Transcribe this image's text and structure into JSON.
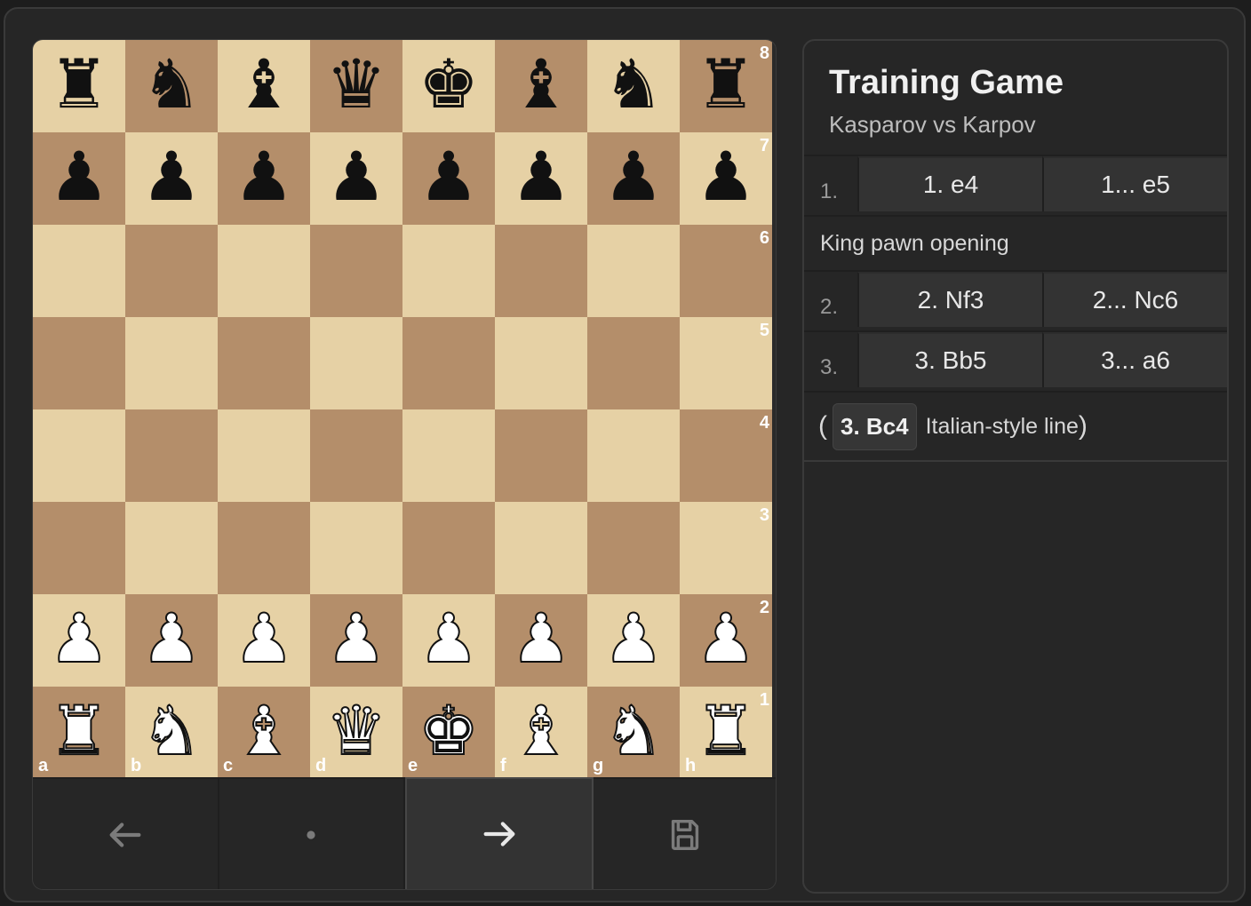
{
  "board": {
    "ranks": [
      "8",
      "7",
      "6",
      "5",
      "4",
      "3",
      "2",
      "1"
    ],
    "files": [
      "a",
      "b",
      "c",
      "d",
      "e",
      "f",
      "g",
      "h"
    ],
    "rows": [
      [
        "br",
        "bn",
        "bb",
        "bq",
        "bk",
        "bb",
        "bn",
        "br"
      ],
      [
        "bp",
        "bp",
        "bp",
        "bp",
        "bp",
        "bp",
        "bp",
        "bp"
      ],
      [
        "",
        "",
        "",
        "",
        "",
        "",
        "",
        ""
      ],
      [
        "",
        "",
        "",
        "",
        "",
        "",
        "",
        ""
      ],
      [
        "",
        "",
        "",
        "",
        "",
        "",
        "",
        ""
      ],
      [
        "",
        "",
        "",
        "",
        "",
        "",
        "",
        ""
      ],
      [
        "wp",
        "wp",
        "wp",
        "wp",
        "wp",
        "wp",
        "wp",
        "wp"
      ],
      [
        "wr",
        "wn",
        "wb",
        "wq",
        "wk",
        "wb",
        "wn",
        "wr"
      ]
    ],
    "light_color": "#e6d1a5",
    "dark_color": "#b48e6a"
  },
  "controls": [
    {
      "icon": "arrow-left-icon"
    },
    {
      "icon": "dot-icon"
    },
    {
      "icon": "arrow-right-icon"
    },
    {
      "icon": "save-icon"
    }
  ],
  "panel": {
    "title": "Training Game",
    "subtitle": "Kasparov vs Karpov",
    "moves": [
      {
        "num": "1.",
        "white": "1. e4",
        "black": "1... e5",
        "comment": "King pawn opening"
      },
      {
        "num": "2.",
        "white": "2. Nf3",
        "black": "2... Nc6",
        "comment": ""
      },
      {
        "num": "3.",
        "white": "3. Bb5",
        "black": "3... a6",
        "comment": ""
      }
    ],
    "variation": {
      "open": "(",
      "move": "3. Bc4",
      "text": "Italian-style line",
      "close": ")"
    }
  }
}
